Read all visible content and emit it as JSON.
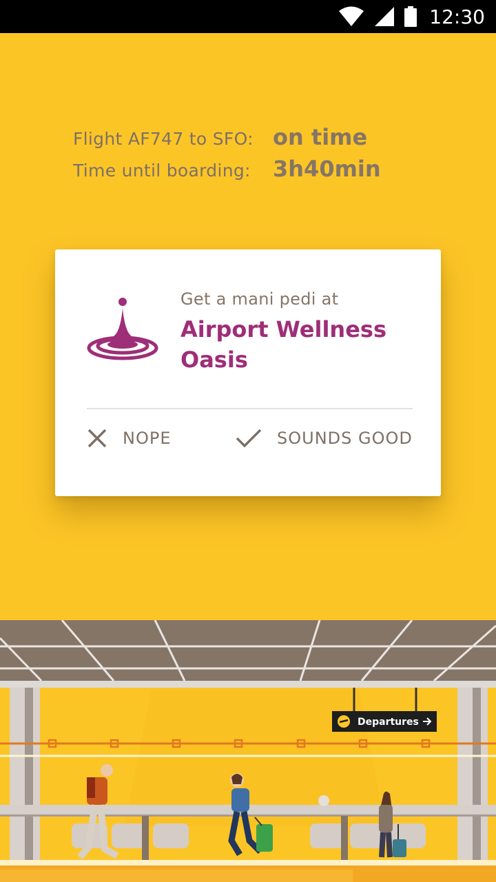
{
  "status_bar": {
    "time": "12:30",
    "icons": [
      "wifi-icon",
      "cell-signal-icon",
      "battery-icon"
    ]
  },
  "flight": {
    "flight_label": "Flight AF747 to SFO:",
    "flight_status": "on time",
    "boarding_label": "Time until boarding:",
    "boarding_time": "3h40min"
  },
  "card": {
    "icon": "spa-icon",
    "subtitle": "Get a mani pedi at",
    "title": "Airport Wellness Oasis",
    "actions": {
      "decline_label": "NOPE",
      "accept_label": "SOUNDS GOOD"
    }
  },
  "scene": {
    "sign_text": "Departures"
  },
  "colors": {
    "background": "#FCC526",
    "accent": "#9E2E78",
    "text_muted": "#857566",
    "status_bar": "#000000"
  }
}
